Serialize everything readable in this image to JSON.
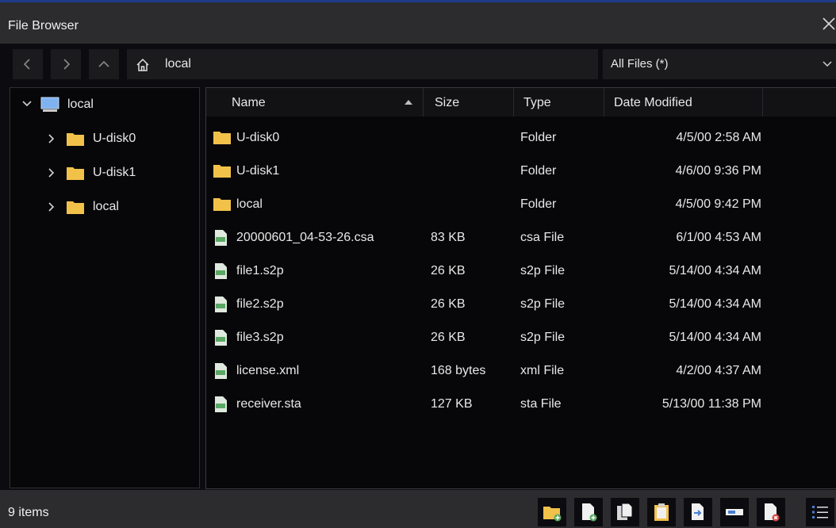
{
  "window": {
    "title": "File Browser"
  },
  "navbar": {
    "path_label": "local",
    "filter_label": "All Files (*)"
  },
  "tree": {
    "items": [
      {
        "label": "local",
        "icon": "computer-icon"
      },
      {
        "label": "U-disk0",
        "icon": "folder-icon"
      },
      {
        "label": "U-disk1",
        "icon": "folder-icon"
      },
      {
        "label": "local",
        "icon": "folder-icon"
      }
    ]
  },
  "list": {
    "columns": {
      "name": "Name",
      "size": "Size",
      "type": "Type",
      "date": "Date Modified"
    },
    "rows": [
      {
        "name": "U-disk0",
        "size": "",
        "type": "Folder",
        "date": "4/5/00 2:58 AM",
        "icon": "folder-icon"
      },
      {
        "name": "U-disk1",
        "size": "",
        "type": "Folder",
        "date": "4/6/00 9:36 PM",
        "icon": "folder-icon"
      },
      {
        "name": "local",
        "size": "",
        "type": "Folder",
        "date": "4/5/00 9:42 PM",
        "icon": "folder-icon"
      },
      {
        "name": "20000601_04-53-26.csa",
        "size": "83 KB",
        "type": "csa File",
        "date": "6/1/00 4:53 AM",
        "icon": "csa-file-icon"
      },
      {
        "name": "file1.s2p",
        "size": "26 KB",
        "type": "s2p File",
        "date": "5/14/00 4:34 AM",
        "icon": "snp-file-icon"
      },
      {
        "name": "file2.s2p",
        "size": "26 KB",
        "type": "s2p File",
        "date": "5/14/00 4:34 AM",
        "icon": "snp-file-icon"
      },
      {
        "name": "file3.s2p",
        "size": "26 KB",
        "type": "s2p File",
        "date": "5/14/00 4:34 AM",
        "icon": "snp-file-icon"
      },
      {
        "name": "license.xml",
        "size": "168 bytes",
        "type": "xml File",
        "date": "4/2/00 4:37 AM",
        "icon": "xml-file-icon"
      },
      {
        "name": "receiver.sta",
        "size": "127 KB",
        "type": "sta File",
        "date": "5/13/00 11:38 PM",
        "icon": "sta-file-icon"
      }
    ]
  },
  "status": {
    "count_label": "9 items"
  },
  "toolbar": {
    "buttons": [
      "new-folder-icon",
      "new-file-icon",
      "copy-icon",
      "paste-icon",
      "move-icon",
      "rename-icon",
      "delete-icon",
      "list-view-icon"
    ]
  },
  "colors": {
    "folder": "#f2c14a",
    "file_green": "#5aa863",
    "accent_line": "#1f3b8a"
  }
}
